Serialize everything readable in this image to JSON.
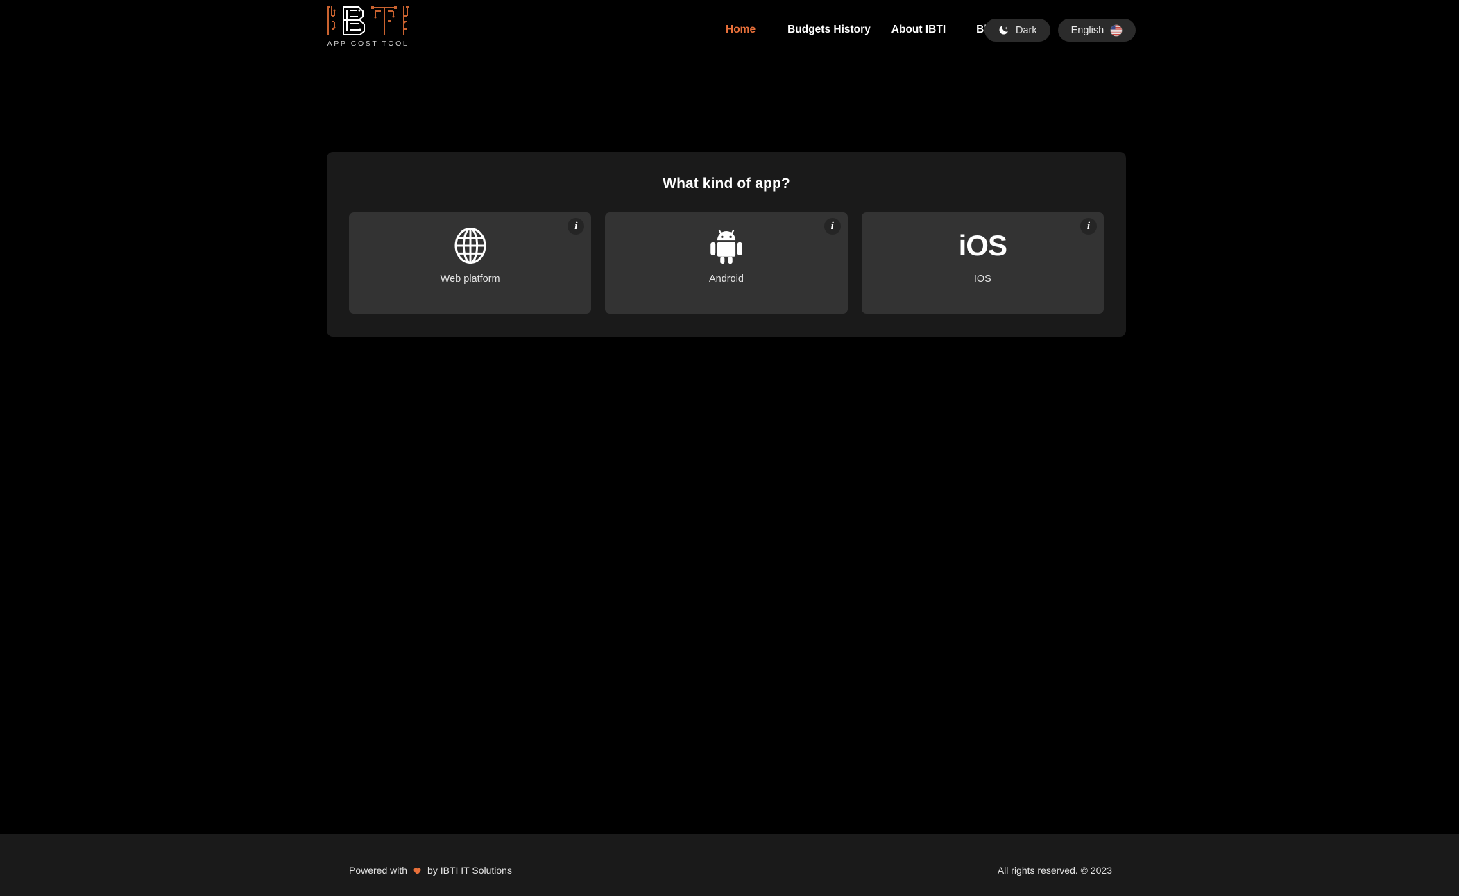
{
  "brand": {
    "logo_text": "IBTI",
    "logo_tagline": "APP COST TOOL",
    "accent_color": "#e8703a",
    "logo_letter_colors": [
      "#c9622f",
      "#ffffff",
      "#c9622f",
      "#c9622f"
    ]
  },
  "nav": {
    "items": [
      {
        "label": "Home",
        "active": true
      },
      {
        "label": "Budgets History",
        "active": false
      },
      {
        "label": "About IBTI",
        "active": false
      },
      {
        "label": "Blog",
        "active": false
      }
    ]
  },
  "controls": {
    "theme_toggle": {
      "label": "Dark",
      "icon": "moon-icon"
    },
    "language_select": {
      "label": "English",
      "icon": "us-flag-icon"
    }
  },
  "main": {
    "panel_title": "What kind of app?",
    "platforms": [
      {
        "label": "Web platform",
        "icon": "globe-icon",
        "info": "i"
      },
      {
        "label": "Android",
        "icon": "android-robot-icon",
        "info": "i"
      },
      {
        "label": "IOS",
        "icon": "ios-wordmark",
        "icon_text": "iOS",
        "info": "i"
      }
    ]
  },
  "footer": {
    "powered_prefix": "Powered with",
    "powered_icon": "heart-icon",
    "powered_suffix": "by IBTI IT Solutions",
    "rights": "All rights reserved. © 2023"
  }
}
